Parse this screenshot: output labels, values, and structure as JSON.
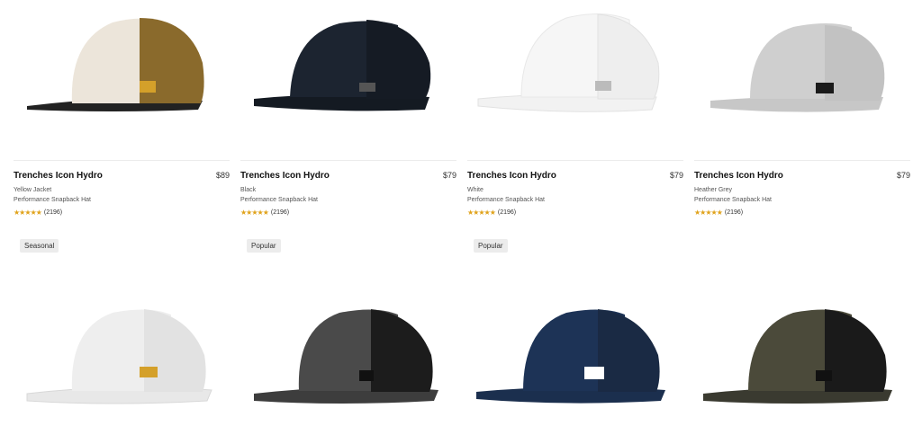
{
  "products_row1": [
    {
      "title": "Trenches Icon Hydro",
      "price": "$89",
      "color": "Yellow Jacket",
      "type": "Performance Snapback Hat",
      "stars": "★★★★★",
      "reviews": "(2196)",
      "badge": "Seasonal"
    },
    {
      "title": "Trenches Icon Hydro",
      "price": "$79",
      "color": "Black",
      "type": "Performance Snapback Hat",
      "stars": "★★★★★",
      "reviews": "(2196)",
      "badge": "Popular"
    },
    {
      "title": "Trenches Icon Hydro",
      "price": "$79",
      "color": "White",
      "type": "Performance Snapback Hat",
      "stars": "★★★★★",
      "reviews": "(2196)",
      "badge": "Popular"
    },
    {
      "title": "Trenches Icon Hydro",
      "price": "$79",
      "color": "Heather Grey",
      "type": "Performance Snapback Hat",
      "stars": "★★★★★",
      "reviews": "(2196)",
      "badge": ""
    }
  ],
  "colors": {
    "star": "#e0a21a",
    "hat1_crown": "#ece5da",
    "hat1_mesh": "#8a6a2c",
    "hat1_bill": "#222222",
    "hat1_logo": "#d4a02a",
    "hat2_crown": "#1c2430",
    "hat2_mesh": "#151b24",
    "hat2_bill": "#141a22",
    "hat2_logo": "#555555",
    "hat3_crown": "#f6f6f6",
    "hat3_mesh": "#eeeeee",
    "hat3_bill": "#f2f2f2",
    "hat3_logo": "#bbbbbb",
    "hat4_crown": "#cfcfcf",
    "hat4_mesh": "#c2c2c2",
    "hat4_bill": "#c7c7c7",
    "hat4_logo": "#1a1a1a",
    "hat5_crown": "#eeeeee",
    "hat5_mesh": "#e2e2e2",
    "hat5_bill": "#e8e8e8",
    "hat5_logo": "#d4a02a",
    "hat6_crown": "#4a4a4a",
    "hat6_mesh": "#1c1c1c",
    "hat6_bill": "#3d3d3d",
    "hat6_logo": "#111111",
    "hat7_crown": "#1d3356",
    "hat7_mesh": "#1a2a44",
    "hat7_bill": "#1b2f4e",
    "hat7_logo": "#ffffff",
    "hat8_crown": "#4b4a3a",
    "hat8_mesh": "#1a1a1a",
    "hat8_bill": "#3a3a30",
    "hat8_logo": "#111111"
  }
}
